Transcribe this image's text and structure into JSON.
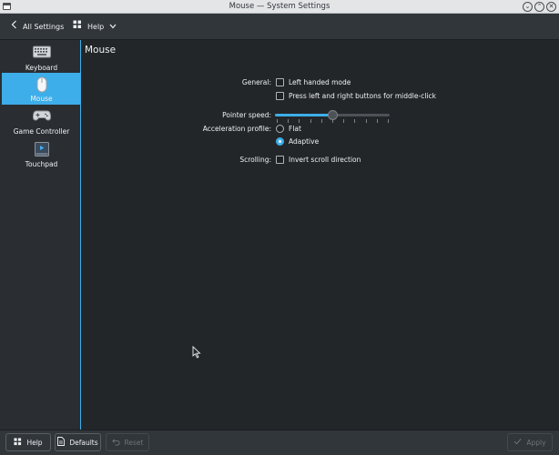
{
  "window": {
    "title": "Mouse — System Settings",
    "controls": {
      "minimize": "⌄",
      "maximize": "⌃",
      "close": "✕"
    }
  },
  "header": {
    "back_label": "All Settings",
    "help_label": "Help"
  },
  "sidebar": {
    "items": [
      {
        "label": "Keyboard",
        "icon": "keyboard-icon",
        "selected": false
      },
      {
        "label": "Mouse",
        "icon": "mouse-icon",
        "selected": true
      },
      {
        "label": "Game Controller",
        "icon": "gamepad-icon",
        "selected": false
      },
      {
        "label": "Touchpad",
        "icon": "touchpad-icon",
        "selected": false
      }
    ]
  },
  "main": {
    "title": "Mouse",
    "general_label": "General:",
    "left_handed_label": "Left handed mode",
    "middle_click_label": "Press left and right buttons for middle-click",
    "pointer_speed_label": "Pointer speed:",
    "pointer_speed_fraction": 0.5,
    "accel_label": "Acceleration profile:",
    "flat_label": "Flat",
    "adaptive_label": "Adaptive",
    "scrolling_label": "Scrolling:",
    "invert_scroll_label": "Invert scroll direction"
  },
  "footer": {
    "help_label": "Help",
    "defaults_label": "Defaults",
    "reset_label": "Reset",
    "apply_label": "Apply"
  },
  "colors": {
    "accent": "#3daee9",
    "background": "#232629",
    "sidebar": "#2a2e32"
  }
}
